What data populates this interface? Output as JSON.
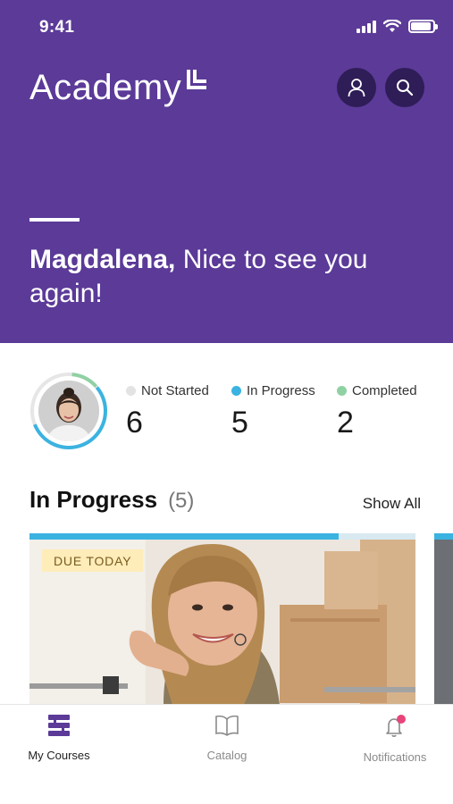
{
  "status_bar": {
    "time": "9:41",
    "icons": [
      "cellular-signal-icon",
      "wifi-icon",
      "battery-icon"
    ]
  },
  "header": {
    "brand": "Academy",
    "brand_mark_icon": "corner-bracket-logo",
    "buttons": [
      {
        "name": "profile",
        "icon": "user-icon"
      },
      {
        "name": "search",
        "icon": "search-icon"
      }
    ],
    "greeting_name": "Magdalena,",
    "greeting_text": " Nice to see you again!",
    "background_color": "#5b3a98"
  },
  "stats": {
    "avatar_ring_progress": 0.55,
    "items": [
      {
        "label": "Not Started",
        "value": "6",
        "color": "#e3e3e3"
      },
      {
        "label": "In Progress",
        "value": "5",
        "color": "#3bb3e1"
      },
      {
        "label": "Completed",
        "value": "2",
        "color": "#8fd1a3"
      }
    ]
  },
  "in_progress": {
    "title": "In Progress",
    "count": "(5)",
    "show_all": "Show All",
    "cards": [
      {
        "tag": "DUE TODAY",
        "progress": 0.8
      }
    ]
  },
  "tabbar": {
    "tabs": [
      {
        "label": "My Courses",
        "icon": "stacked-courses-icon",
        "active": true
      },
      {
        "label": "Catalog",
        "icon": "open-book-icon",
        "active": false
      },
      {
        "label": "Notifications",
        "icon": "bell-icon",
        "active": false,
        "badge": true
      }
    ],
    "accent": "#5b3a98",
    "badge_color": "#e8457a"
  }
}
